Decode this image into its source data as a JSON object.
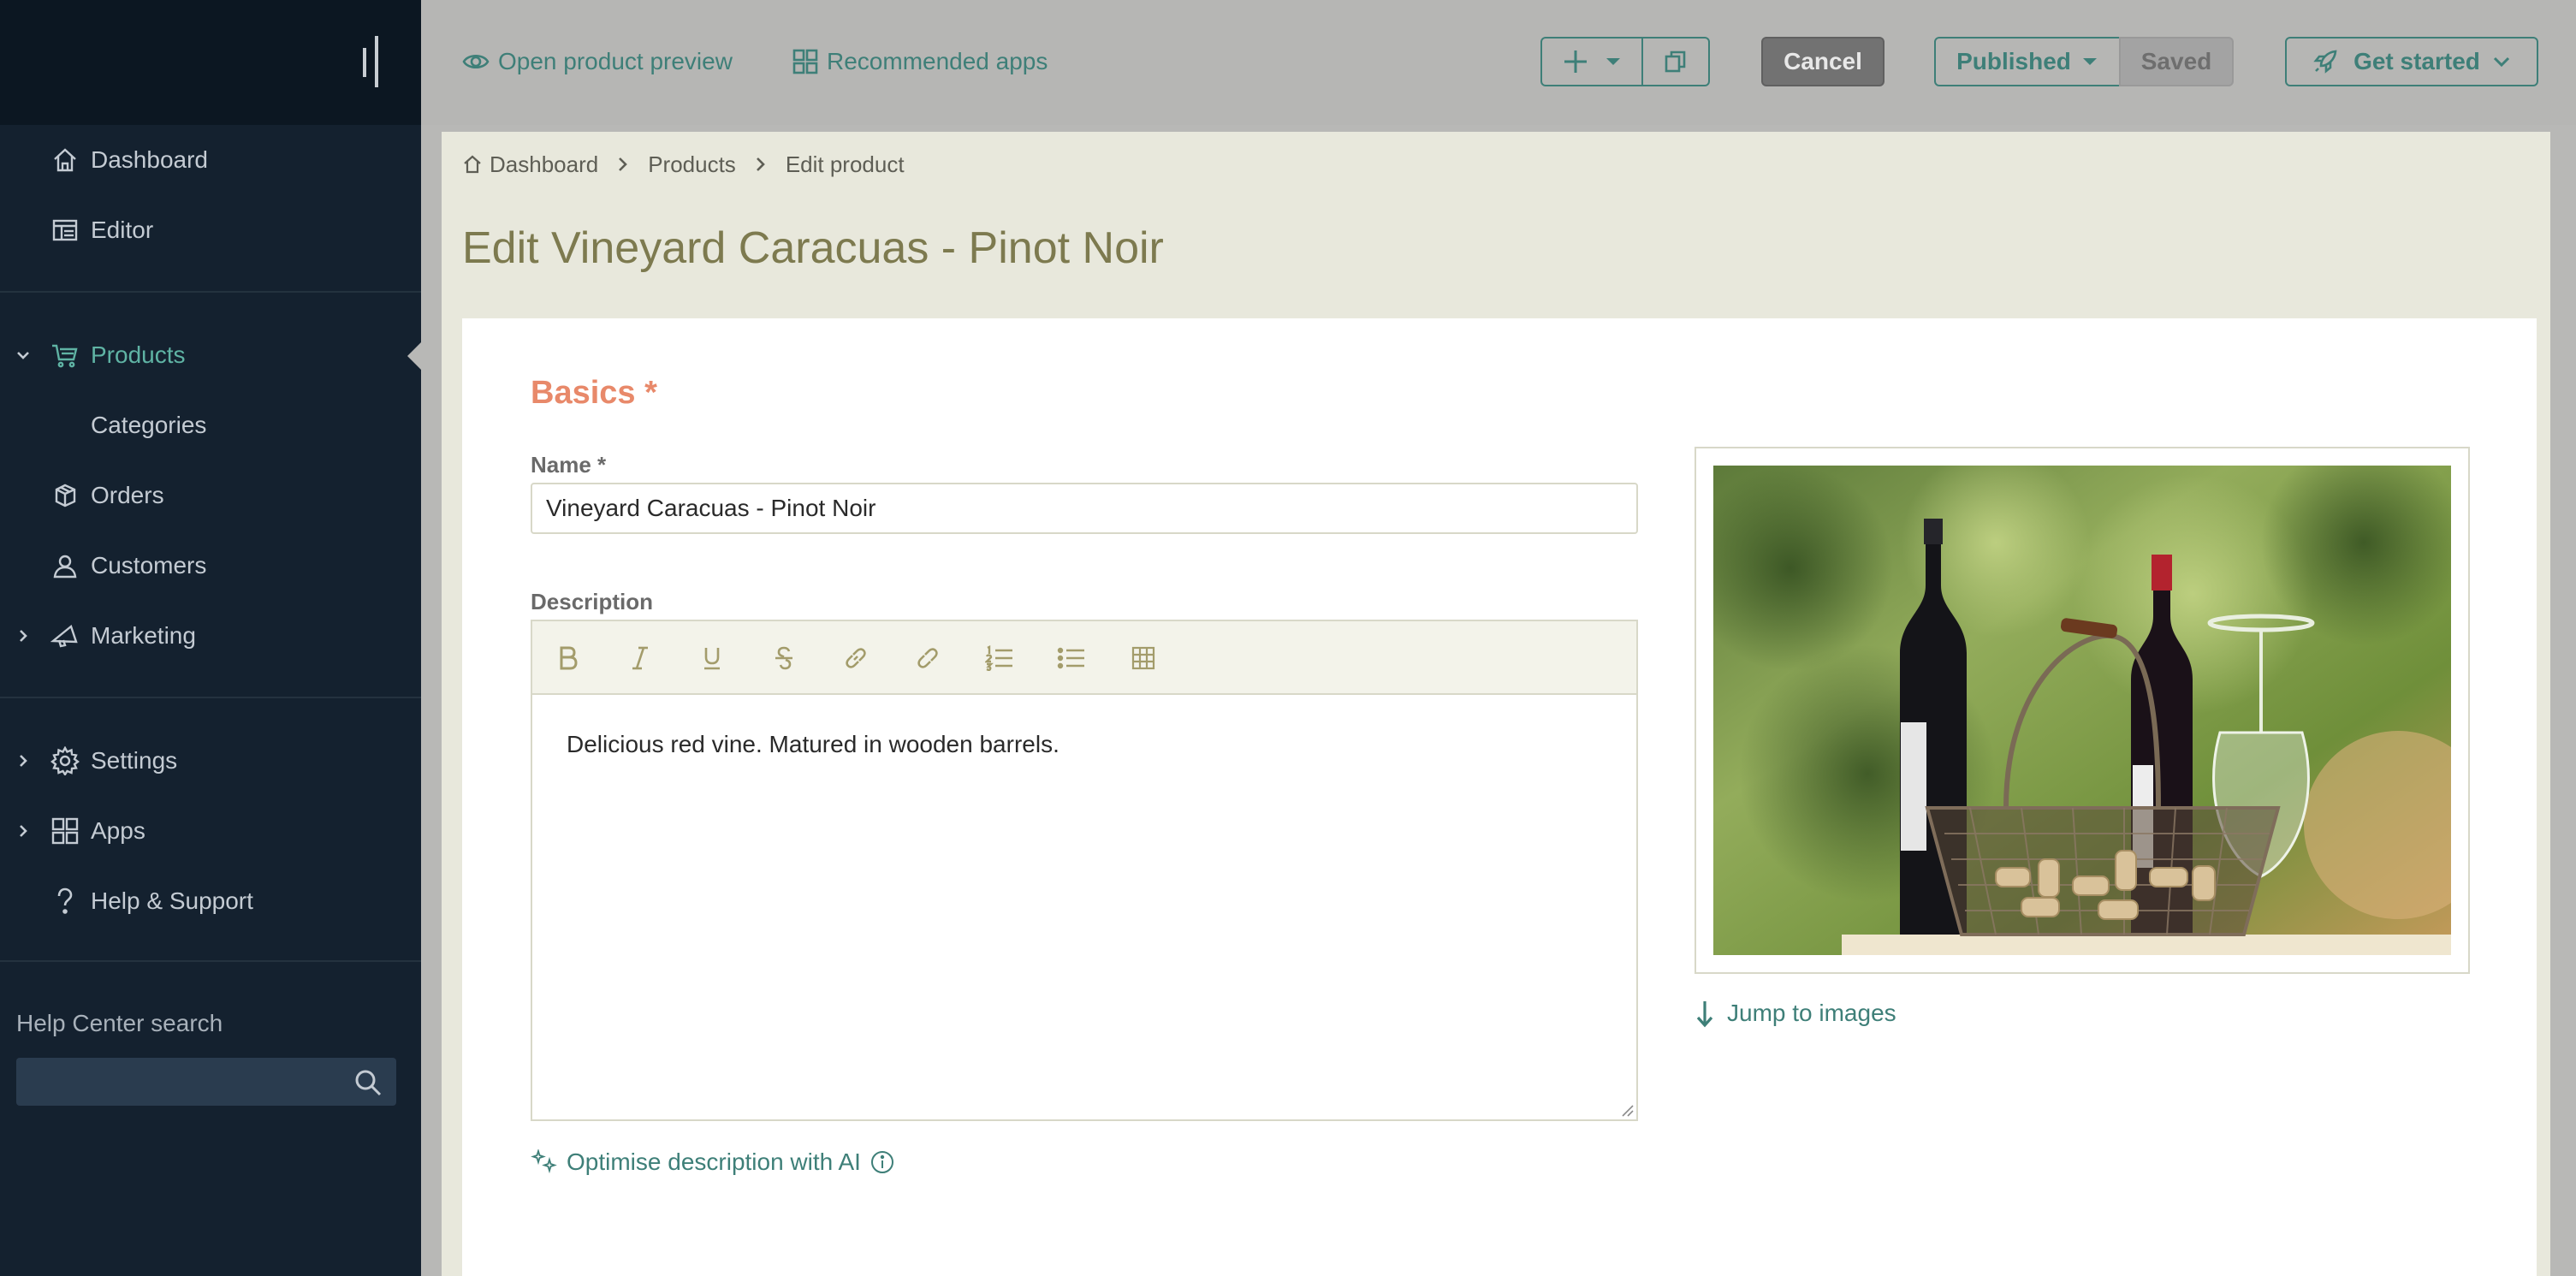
{
  "sidebar": {
    "items": [
      {
        "label": "Dashboard"
      },
      {
        "label": "Editor"
      },
      {
        "label": "Products"
      },
      {
        "label": "Categories"
      },
      {
        "label": "Orders"
      },
      {
        "label": "Customers"
      },
      {
        "label": "Marketing"
      },
      {
        "label": "Settings"
      },
      {
        "label": "Apps"
      },
      {
        "label": "Help & Support"
      }
    ],
    "help_center": {
      "label": "Help Center search",
      "value": "",
      "placeholder": ""
    }
  },
  "topbar": {
    "preview_label": "Open product preview",
    "recommended_label": "Recommended apps",
    "cancel_label": "Cancel",
    "published_label": "Published",
    "saved_label": "Saved",
    "get_started_label": "Get started"
  },
  "breadcrumb": [
    "Dashboard",
    "Products",
    "Edit product"
  ],
  "page": {
    "title": "Edit Vineyard Caracuas - Pinot Noir"
  },
  "basics": {
    "section_title": "Basics *",
    "name_label": "Name *",
    "name_value": "Vineyard Caracuas - Pinot Noir",
    "description_label": "Description",
    "description_text": "Delicious red vine. Matured in wooden barrels.",
    "toolbar": [
      "bold-icon",
      "italic-icon",
      "underline-icon",
      "strikethrough-icon",
      "link-icon",
      "unlink-icon",
      "ordered-list-icon",
      "bullet-list-icon",
      "table-icon"
    ],
    "ai_label": "Optimise description with AI",
    "jump_label": "Jump to images"
  },
  "colors": {
    "sidebar": "#14212f",
    "accent": "#3e7f78",
    "active": "#5fb3a4",
    "section": "#e8896a",
    "title": "#7d7a4f"
  }
}
